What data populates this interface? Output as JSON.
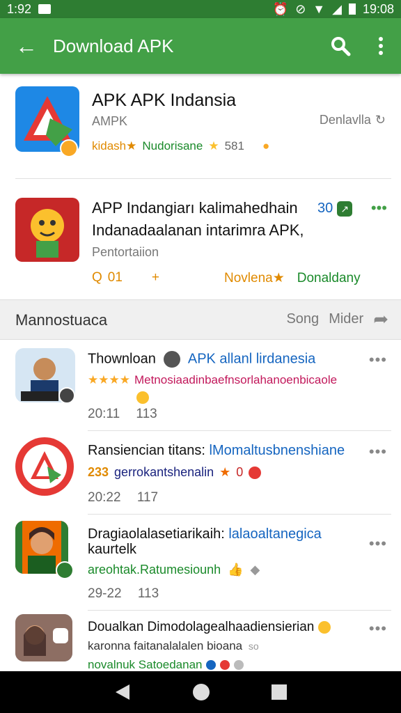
{
  "status": {
    "time": "1:92",
    "clock": "19:08"
  },
  "appbar": {
    "title": "Download APK"
  },
  "featured": [
    {
      "title": "APK APK Indansia",
      "subtitle": "AMPK",
      "right_label": "Denlavlla",
      "meta_orange": "kidash★",
      "meta_green": "Nudorisane",
      "rating": "581"
    },
    {
      "title_line1": "APP Indangiarı kalimahedhain",
      "title_line2": "Indanadaalanan intarimra APK,",
      "badge": "30",
      "subtitle": "Pentortaiion",
      "meta_left": "01",
      "meta_orange": "Novlena★",
      "meta_green": "Donaldany"
    }
  ],
  "section": {
    "label": "Mannostuaca",
    "sort": "Song",
    "filter": "Mider"
  },
  "list": [
    {
      "title_black": "Thownloan",
      "title_blue": "APK allanl lirdanesia",
      "line2": "Metnosiaadinbaefnsorlahanoenbicaole",
      "time": "20:11",
      "count": "113"
    },
    {
      "title_black": "Ransiencian titans:",
      "title_blue": "lMomaltusbnenshiane",
      "line2_num": "233",
      "line2_text": "gerrokantshenalin",
      "line2_rating": "0",
      "time": "20:22",
      "count": "117"
    },
    {
      "title_black": "Dragiaolalasetiarikaih:",
      "title_blue": "lalaoaltanegica",
      "title_line2": "kaurtelk",
      "line3_green": "areohtak.Ratumesiounh",
      "time": "29-22",
      "count": "113"
    },
    {
      "title_black": "Doualkan Dimodolagealhaadiensierian",
      "line2_text": "karonna faitanalalalen bioana",
      "line2_small": "so",
      "line3_green": "novalnuk Satoedanan"
    }
  ],
  "colors": {
    "primary": "#43a047",
    "status": "#2e7d32",
    "accent_blue": "#1565c0"
  }
}
